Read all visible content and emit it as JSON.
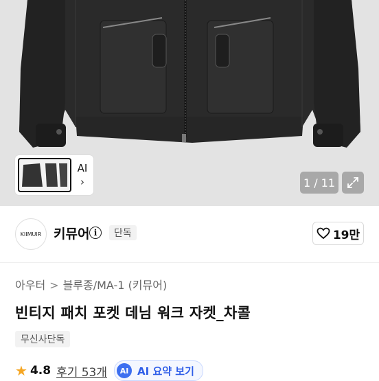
{
  "gallery": {
    "thumb_ai_label": "AI",
    "thumb_chevron": "›",
    "counter": "1 / 11",
    "expand_icon": "expand-icon"
  },
  "brand": {
    "logo_text": "KIIMUIR",
    "name": "키뮤어",
    "badge": "단독",
    "likes": "19만"
  },
  "breadcrumb": {
    "items": [
      "아우터",
      "블루종/MA-1 (키뮤어)"
    ],
    "separator": ">"
  },
  "product": {
    "title": "빈티지 패치 포켓 데님 워크 자켓_차콜",
    "tag": "무신사단독"
  },
  "rating": {
    "score": "4.8",
    "reviews": "후기 53개",
    "ai_badge": "AI",
    "ai_summary": "AI 요약 보기"
  },
  "colors": {
    "accent": "#3d6ff0",
    "star": "#f5a623",
    "hero_bg": "#e3e3e3"
  }
}
